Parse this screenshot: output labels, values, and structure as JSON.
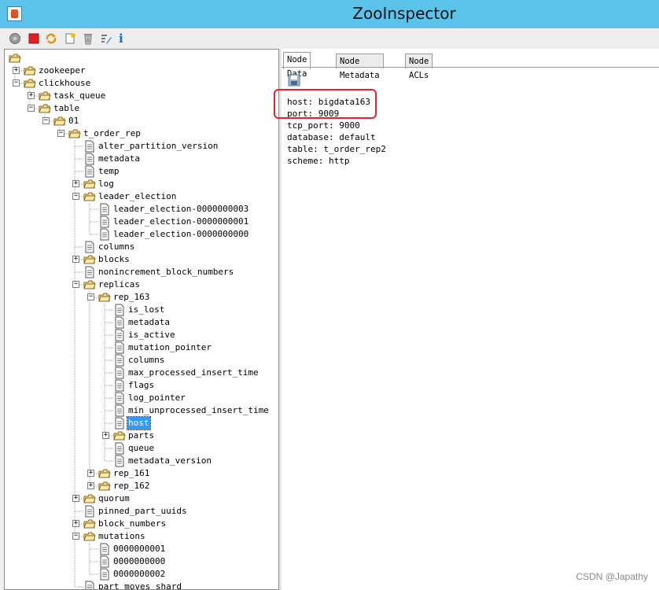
{
  "window": {
    "title": "ZooInspector"
  },
  "toolbar": {
    "info_glyph": "i"
  },
  "tree": [
    {
      "label": "",
      "d": 0,
      "kind": "folder",
      "exp": null
    },
    {
      "label": "zookeeper",
      "d": 1,
      "kind": "folder",
      "exp": "+"
    },
    {
      "label": "clickhouse",
      "d": 1,
      "kind": "folder",
      "exp": "-"
    },
    {
      "label": "task_queue",
      "d": 2,
      "kind": "folder",
      "exp": "+"
    },
    {
      "label": "table",
      "d": 2,
      "kind": "folder",
      "exp": "-"
    },
    {
      "label": "01",
      "d": 3,
      "kind": "folder",
      "exp": "-"
    },
    {
      "label": "t_order_rep",
      "d": 4,
      "kind": "folder",
      "exp": "-"
    },
    {
      "label": "alter_partition_version",
      "d": 5,
      "kind": "file",
      "exp": null
    },
    {
      "label": "metadata",
      "d": 5,
      "kind": "file",
      "exp": null
    },
    {
      "label": "temp",
      "d": 5,
      "kind": "file",
      "exp": null
    },
    {
      "label": "log",
      "d": 5,
      "kind": "folder",
      "exp": "+"
    },
    {
      "label": "leader_election",
      "d": 5,
      "kind": "folder",
      "exp": "-"
    },
    {
      "label": "leader_election-0000000003",
      "d": 6,
      "kind": "file",
      "exp": null
    },
    {
      "label": "leader_election-0000000001",
      "d": 6,
      "kind": "file",
      "exp": null
    },
    {
      "label": "leader_election-0000000000",
      "d": 6,
      "kind": "file",
      "exp": null
    },
    {
      "label": "columns",
      "d": 5,
      "kind": "file",
      "exp": null
    },
    {
      "label": "blocks",
      "d": 5,
      "kind": "folder",
      "exp": "+"
    },
    {
      "label": "nonincrement_block_numbers",
      "d": 5,
      "kind": "file",
      "exp": null
    },
    {
      "label": "replicas",
      "d": 5,
      "kind": "folder",
      "exp": "-"
    },
    {
      "label": "rep_163",
      "d": 6,
      "kind": "folder",
      "exp": "-"
    },
    {
      "label": "is_lost",
      "d": 7,
      "kind": "file",
      "exp": null
    },
    {
      "label": "metadata",
      "d": 7,
      "kind": "file",
      "exp": null
    },
    {
      "label": "is_active",
      "d": 7,
      "kind": "file",
      "exp": null
    },
    {
      "label": "mutation_pointer",
      "d": 7,
      "kind": "file",
      "exp": null
    },
    {
      "label": "columns",
      "d": 7,
      "kind": "file",
      "exp": null
    },
    {
      "label": "max_processed_insert_time",
      "d": 7,
      "kind": "file",
      "exp": null
    },
    {
      "label": "flags",
      "d": 7,
      "kind": "file",
      "exp": null
    },
    {
      "label": "log_pointer",
      "d": 7,
      "kind": "file",
      "exp": null
    },
    {
      "label": "min_unprocessed_insert_time",
      "d": 7,
      "kind": "file",
      "exp": null
    },
    {
      "label": "host",
      "d": 7,
      "kind": "file",
      "exp": null,
      "selected": true
    },
    {
      "label": "parts",
      "d": 7,
      "kind": "folder",
      "exp": "+"
    },
    {
      "label": "queue",
      "d": 7,
      "kind": "file",
      "exp": null
    },
    {
      "label": "metadata_version",
      "d": 7,
      "kind": "file",
      "exp": null
    },
    {
      "label": "rep_161",
      "d": 6,
      "kind": "folder",
      "exp": "+"
    },
    {
      "label": "rep_162",
      "d": 6,
      "kind": "folder",
      "exp": "+"
    },
    {
      "label": "quorum",
      "d": 5,
      "kind": "folder",
      "exp": "+"
    },
    {
      "label": "pinned_part_uuids",
      "d": 5,
      "kind": "file",
      "exp": null
    },
    {
      "label": "block_numbers",
      "d": 5,
      "kind": "folder",
      "exp": "+"
    },
    {
      "label": "mutations",
      "d": 5,
      "kind": "folder",
      "exp": "-"
    },
    {
      "label": "0000000001",
      "d": 6,
      "kind": "file",
      "exp": null
    },
    {
      "label": "0000000000",
      "d": 6,
      "kind": "file",
      "exp": null
    },
    {
      "label": "0000000002",
      "d": 6,
      "kind": "file",
      "exp": null
    },
    {
      "label": "part_moves_shard",
      "d": 5,
      "kind": "file",
      "exp": null
    }
  ],
  "tabs": [
    "Node Data",
    "Node Metadata",
    "Node ACLs"
  ],
  "node_data": [
    "host: bigdata163",
    "port: 9009",
    "tcp_port: 9000",
    "database: default",
    "table: t_order_rep2",
    "scheme: http"
  ],
  "watermark": "CSDN @Japathy",
  "colors": {
    "titlebar": "#5bc3ea",
    "selection": "#3399ff",
    "annotation": "#e8242a"
  }
}
